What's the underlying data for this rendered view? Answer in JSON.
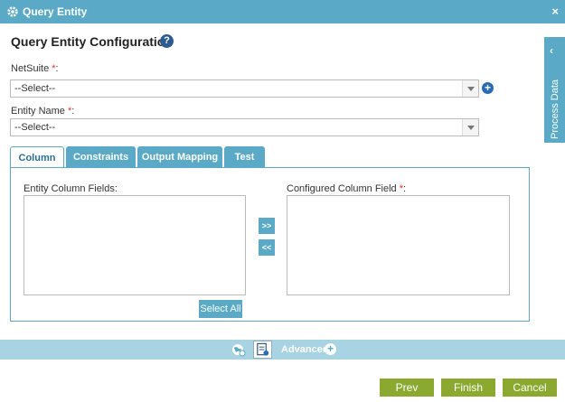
{
  "window": {
    "title": "Query Entity"
  },
  "heading": "Query Entity Configuration",
  "fields": {
    "netsuite": {
      "label": "NetSuite",
      "required": "*",
      "colon": ":",
      "value": "--Select--"
    },
    "entity_name": {
      "label": "Entity Name",
      "required": "*",
      "colon": ":",
      "value": "--Select--"
    }
  },
  "side_tab": {
    "label": "Process Data"
  },
  "tabs": [
    {
      "label": "Column"
    },
    {
      "label": "Constraints"
    },
    {
      "label": "Output Mapping"
    },
    {
      "label": "Test"
    }
  ],
  "column_panel": {
    "entity_fields_label": "Entity Column Fields:",
    "configured_label": "Configured Column Field",
    "configured_required": "*",
    "configured_colon": ":",
    "add_button": ">>",
    "remove_button": "<<",
    "select_all": "Select All"
  },
  "toolbar": {
    "advanced": "Advanced"
  },
  "footer": {
    "prev": "Prev",
    "finish": "Finish",
    "cancel": "Cancel"
  },
  "colors": {
    "accent": "#5aa9c6",
    "toolbar": "#a8d3e3",
    "primary_button": "#8ba82f"
  }
}
